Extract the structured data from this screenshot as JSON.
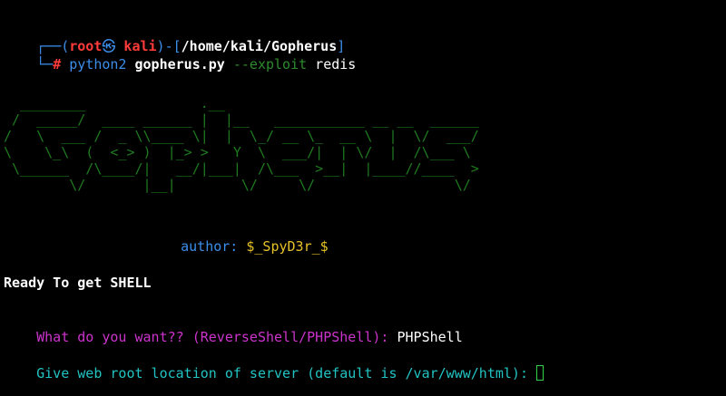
{
  "prompt": {
    "corner_top": "┌──(",
    "user": "root",
    "at_symbol": "㉿",
    "host": " kali",
    "path_open": ")-[",
    "path": "/home/kali/Gopherus",
    "path_close": "]",
    "corner_bottom": "└─",
    "hash": "# ",
    "cmd_interpreter": "python2 ",
    "cmd_script": "gopherus.py",
    "cmd_flag": " --exploit",
    "cmd_arg": " redis"
  },
  "banner": {
    "ascii_art": "  ________              .__\n /  _____/  ____ ______ |  |__   ___________ __ __  ______\n/   \\  ___ /  _ \\\\____ \\|  |  \\_/ __ \\_  __ \\  |  \\/  ___/\n\\    \\_\\  (  <_> )  |_> >   Y  \\  ___/|  | \\/  |  /\\___ \\\n \\______  /\\____/|   __/|___|  /\\___  >__|  |____//____  >\n        \\/       |__|        \\/     \\/                 \\/",
    "author_label": "author: ",
    "author_name": "$_SpyD3r_$"
  },
  "output": {
    "ready_line": "Ready To get SHELL",
    "q1_prompt": "What do you want?? (ReverseShell/PHPShell): ",
    "q1_answer": "PHPShell",
    "q2_prompt": "Give web root location of server (default is /var/www/html): "
  },
  "colors": {
    "background": "#000000",
    "prompt_blue": "#3b8eea",
    "root_red": "#ff3b3b",
    "banner_green": "#1f7a1f",
    "magenta": "#cc33cc",
    "cyan": "#22c3c3",
    "yellow": "#e6c229",
    "cursor_green": "#32d24a"
  }
}
